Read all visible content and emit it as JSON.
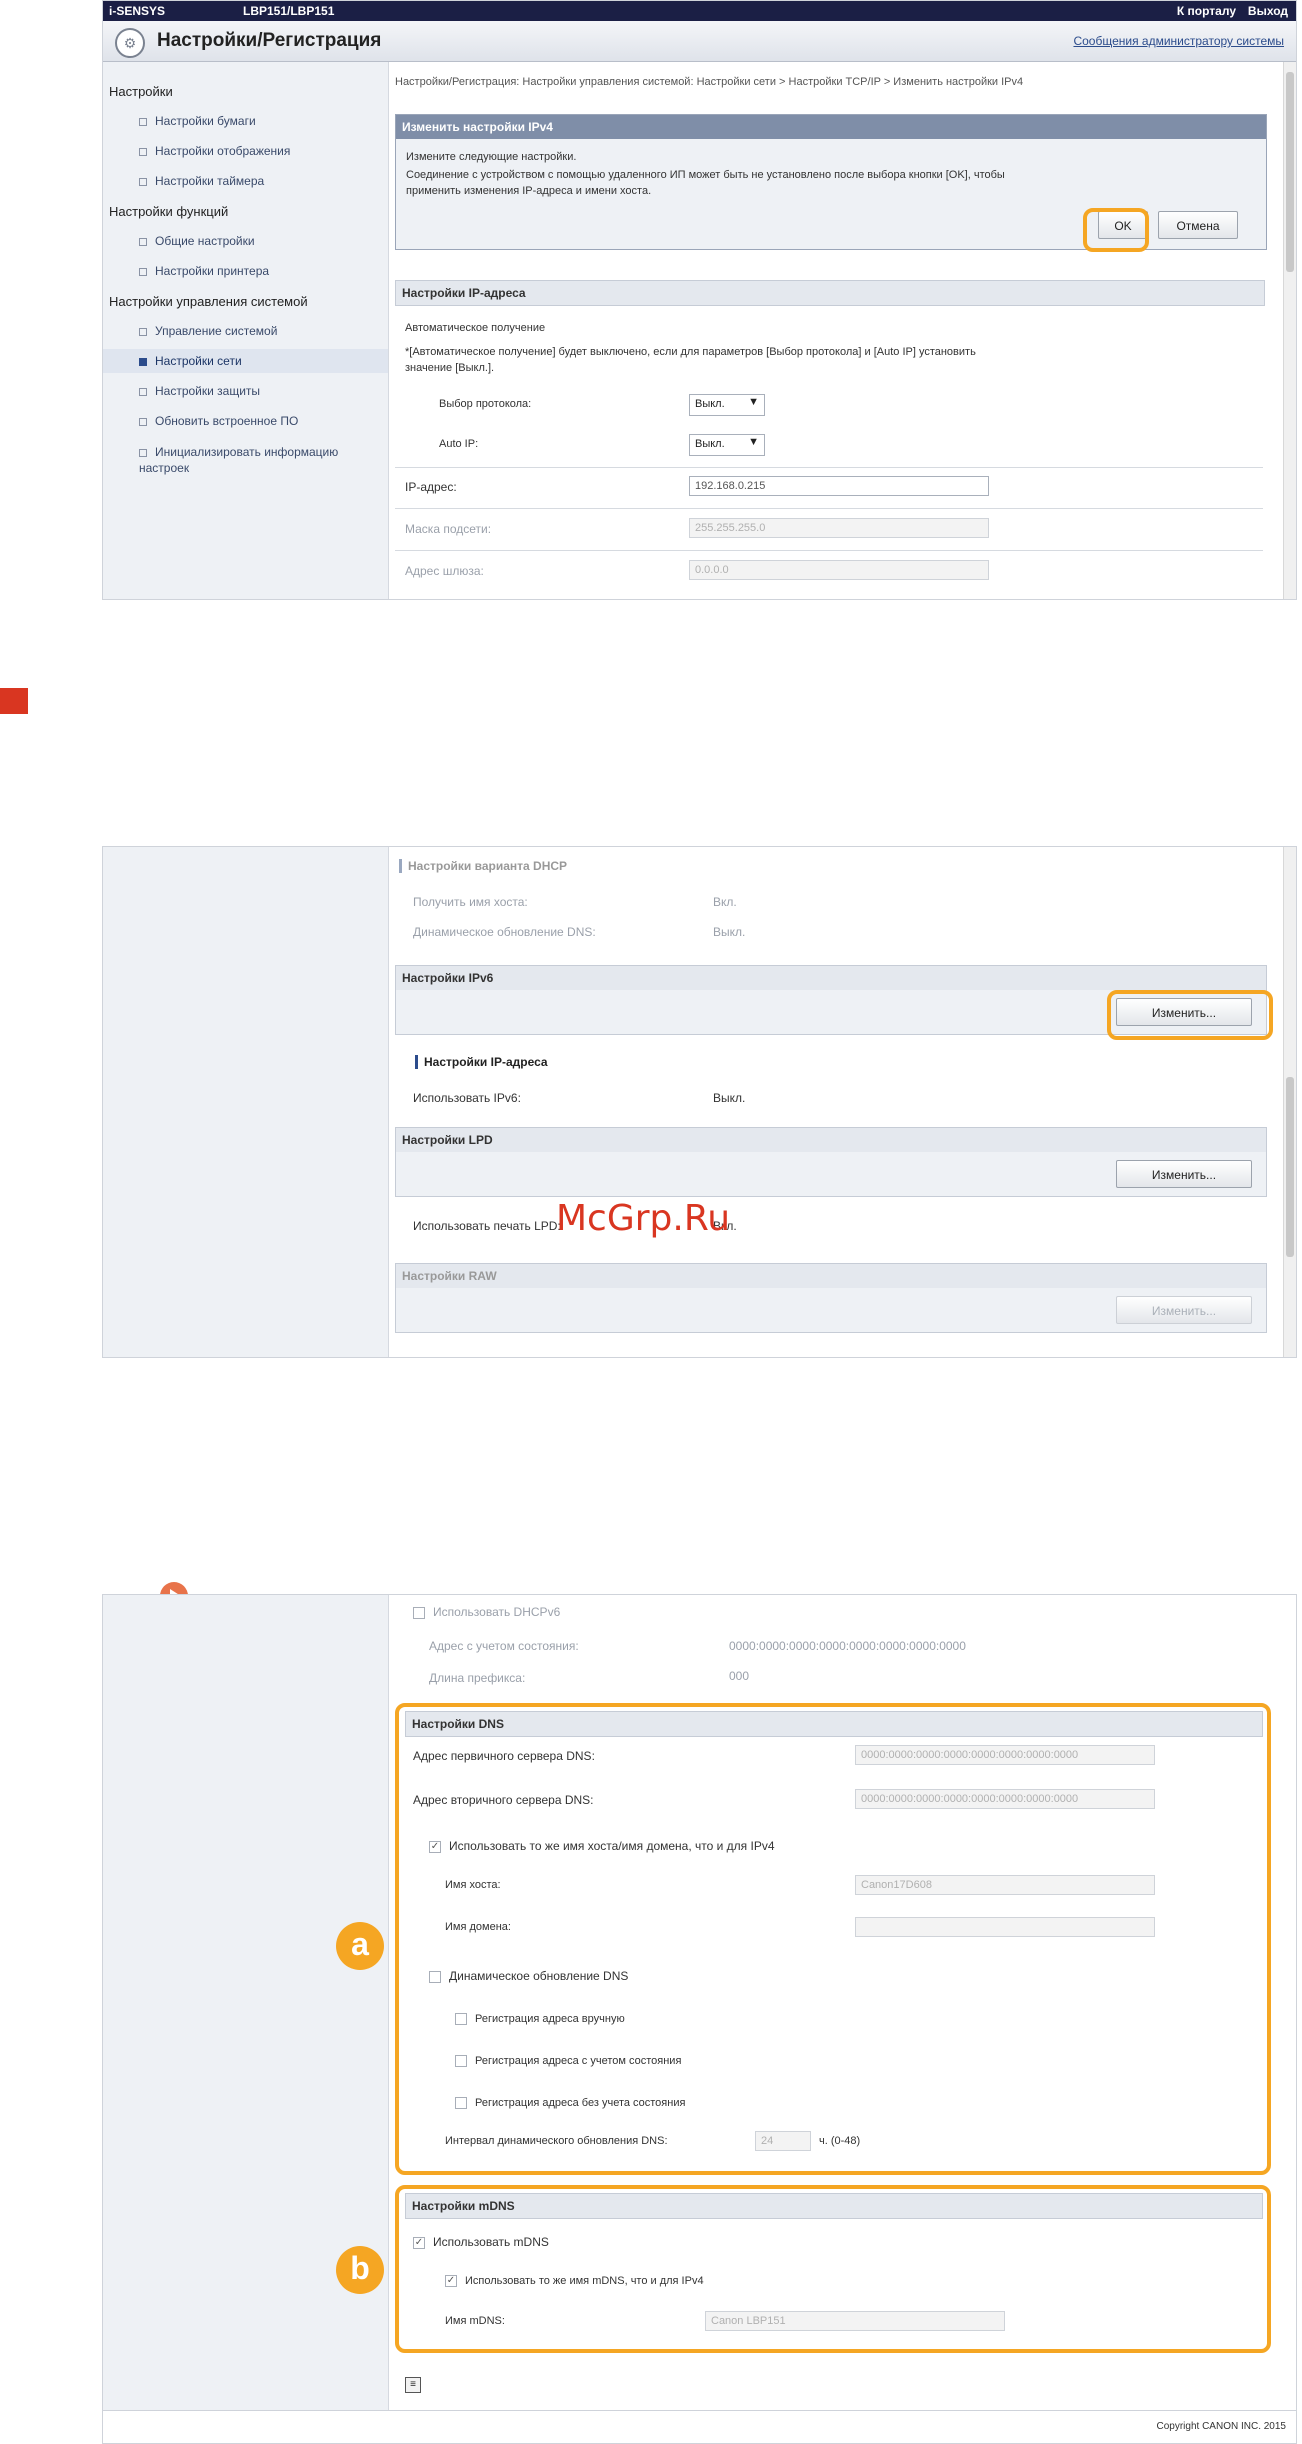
{
  "colors": {
    "accent": "#f5a623",
    "brand_dark": "#1b1f45",
    "link": "#2c4c8c",
    "marker": "#d93621"
  },
  "top": {
    "brand": "i-SENSYS",
    "model": "LBP151/LBP151",
    "portal_link": "К порталу",
    "logout_link": "Выход",
    "title": "Настройки/Регистрация",
    "admin_message_link": "Сообщения администратору системы",
    "logo_icon": "settings-wheel-icon"
  },
  "sidebar": {
    "sections": [
      {
        "label": "Настройки",
        "items": [
          "Настройки бумаги",
          "Настройки отображения",
          "Настройки таймера"
        ]
      },
      {
        "label": "Настройки функций",
        "items": [
          "Общие настройки",
          "Настройки принтера"
        ]
      },
      {
        "label": "Настройки управления системой",
        "items": [
          "Управление системой",
          "Настройки сети",
          "Настройки защиты",
          "Обновить встроенное ПО",
          "Инициализировать информацию настроек"
        ]
      }
    ],
    "selected": "Настройки сети"
  },
  "shot1": {
    "breadcrumb": "Настройки/Регистрация: Настройки управления системой: Настройки сети > Настройки TCP/IP > Изменить настройки IPv4",
    "dialog_title": "Изменить настройки IPv4",
    "dialog_line1": "Измените следующие настройки.",
    "dialog_line2": "Соединение с устройством с помощью удаленного ИП может быть не установлено после выбора кнопки [OK], чтобы",
    "dialog_line3": "применить изменения IP-адреса и имени хоста.",
    "ok_button": "OK",
    "cancel_button": "Отмена",
    "ip_settings_head": "Настройки IP-адреса",
    "auto_get": "Автоматическое получение",
    "auto_note1": "*[Автоматическое получение] будет выключено, если для параметров [Выбор протокола] и [Auto IP] установить",
    "auto_note2": "значение [Выкл.].",
    "protocol_label": "Выбор протокола:",
    "protocol_value": "Выкл.",
    "autoip_label": "Auto IP:",
    "autoip_value": "Выкл.",
    "ip_label": "IP-адрес:",
    "ip_value": "192.168.0.215",
    "mask_label": "Маска подсети:",
    "mask_value": "255.255.255.0",
    "gateway_label": "Адрес шлюза:",
    "gateway_value": "0.0.0.0"
  },
  "shot2": {
    "dhcp_head": "Настройки варианта DHCP",
    "get_hostname_label": "Получить имя хоста:",
    "get_hostname_value": "Вкл.",
    "dyn_dns_label": "Динамическое обновление DNS:",
    "dyn_dns_value": "Выкл.",
    "ipv6_head": "Настройки IPv6",
    "change_button": "Изменить...",
    "ip_head": "Настройки IP-адреса",
    "use_ipv6_label": "Использовать IPv6:",
    "use_ipv6_value": "Выкл.",
    "lpd_head": "Настройки LPD",
    "use_lpd_label": "Использовать печать LPD:",
    "use_lpd_value": "Вкл.",
    "raw_head": "Настройки RAW",
    "watermark": "McGrp.Ru"
  },
  "shot3": {
    "use_dhcpv6": "Использовать DHCPv6",
    "stateful_label": "Адрес с учетом состояния:",
    "stateful_value": "0000:0000:0000:0000:0000:0000:0000:0000",
    "prefix_label": "Длина префикса:",
    "prefix_value": "000",
    "dns_head": "Настройки DNS",
    "dns_primary_label": "Адрес первичного сервера DNS:",
    "dns_primary_value": "0000:0000:0000:0000:0000:0000:0000:0000",
    "dns_secondary_label": "Адрес вторичного сервера DNS:",
    "dns_secondary_value": "0000:0000:0000:0000:0000:0000:0000:0000",
    "same_host_label": "Использовать то же имя хоста/имя домена, что и для IPv4",
    "host_label": "Имя хоста:",
    "host_value": "Canon17D608",
    "domain_label": "Имя домена:",
    "dyn_update_label": "Динамическое обновление DNS",
    "reg_manual": "Регистрация адреса вручную",
    "reg_stateful": "Регистрация адреса с учетом состояния",
    "reg_stateless": "Регистрация адреса без учета состояния",
    "interval_label": "Интервал динамического обновления DNS:",
    "interval_value": "24",
    "interval_unit": "ч. (0-48)",
    "mdns_head": "Настройки mDNS",
    "use_mdns": "Использовать mDNS",
    "same_mdns": "Использовать то же имя mDNS, что и для IPv4",
    "mdns_name_label": "Имя mDNS:",
    "mdns_name_value": "Canon LBP151",
    "badge_a": "a",
    "badge_b": "b",
    "footer_icon": "page-top-icon",
    "copyright": "Copyright CANON INC. 2015"
  }
}
